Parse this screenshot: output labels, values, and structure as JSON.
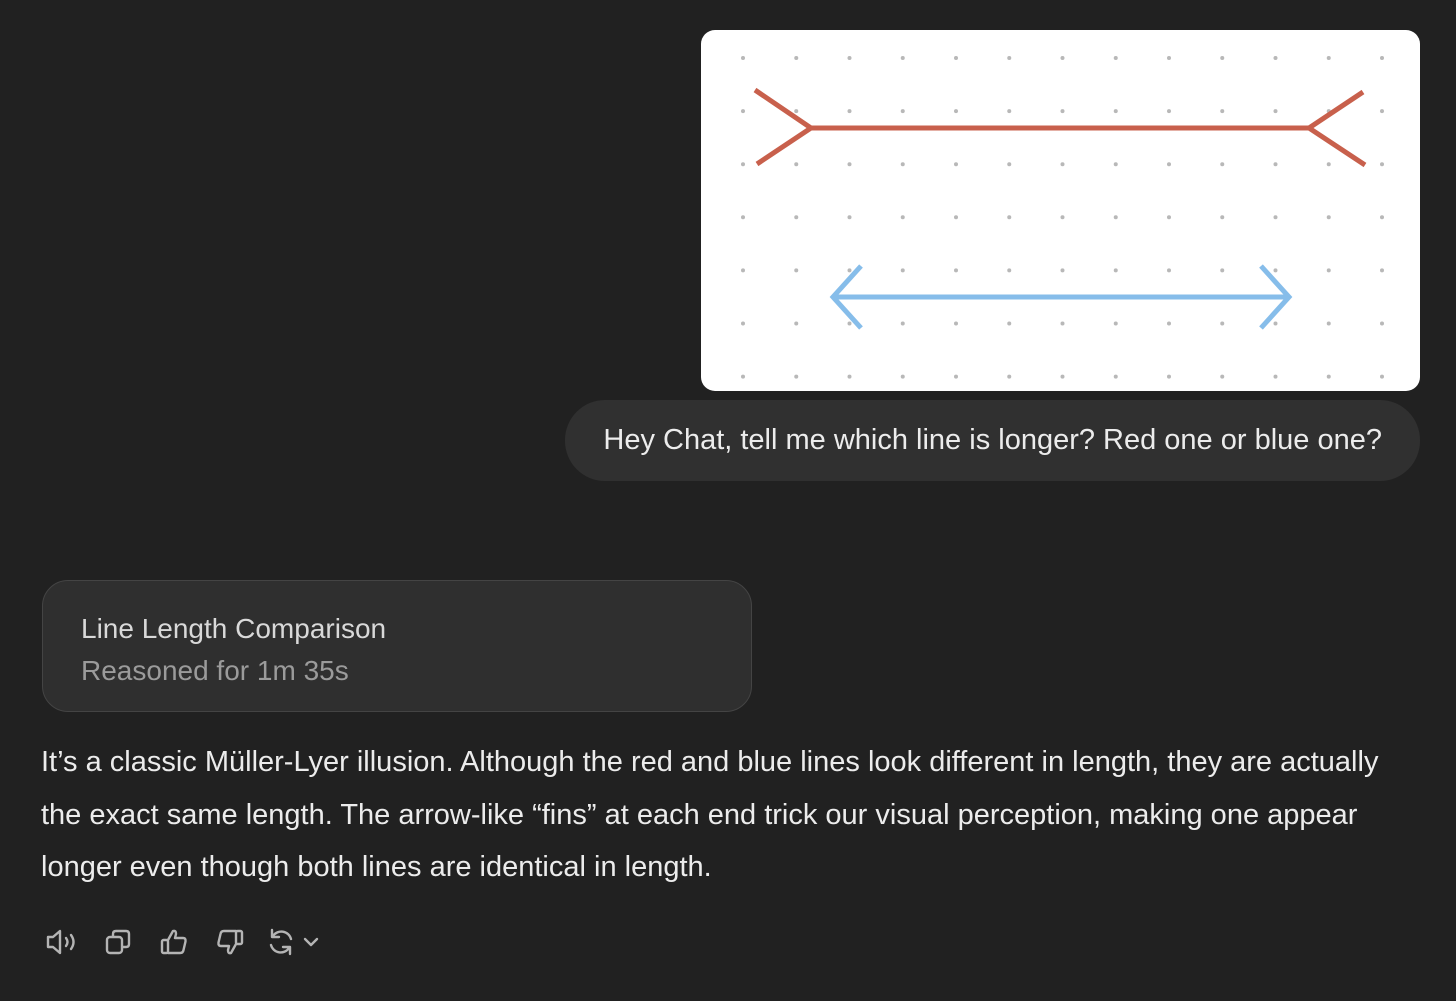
{
  "user_message": {
    "image": {
      "icon": "muller-lyer-illusion-image",
      "colors": {
        "background": "#ffffff",
        "dots": "#b8b8b8",
        "red_line": "#c8604c",
        "blue_line": "#86bdea"
      }
    },
    "text": "Hey Chat, tell me which line is longer? Red one or blue one?"
  },
  "reasoning": {
    "title": "Line Length Comparison",
    "subtitle": "Reasoned for 1m 35s"
  },
  "assistant_message": {
    "text": "It’s a classic Müller-Lyer illusion. Although the red and blue lines look different in length, they are actually the exact same length. The arrow-like “fins” at each end trick our visual perception, making one appear longer even though both lines are identical in length."
  },
  "actions": [
    {
      "name": "read-aloud-button",
      "icon": "speaker-icon"
    },
    {
      "name": "copy-button",
      "icon": "copy-icon"
    },
    {
      "name": "thumbs-up-button",
      "icon": "thumbs-up-icon"
    },
    {
      "name": "thumbs-down-button",
      "icon": "thumbs-down-icon"
    },
    {
      "name": "regenerate-button",
      "icon": "refresh-icon"
    }
  ],
  "colors": {
    "page_background": "#212121",
    "bubble_background": "#303030",
    "card_background": "#2f2f2f",
    "text_primary": "#ececec",
    "text_secondary": "#9b9b9b"
  }
}
